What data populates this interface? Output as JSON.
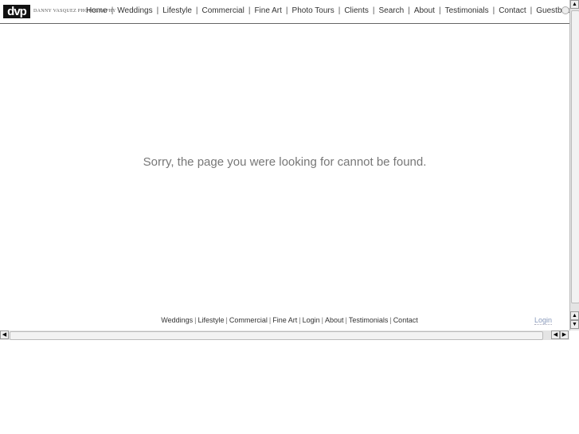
{
  "header": {
    "logo": "dvp",
    "brand": "DANNY VASQUEZ PHOTOGRAPHY",
    "nav": [
      "Home",
      "Weddings",
      "Lifestyle",
      "Commercial",
      "Fine Art",
      "Photo Tours",
      "Clients",
      "Search",
      "About",
      "Testimonials",
      "Contact",
      "Guestbook"
    ],
    "separator": "|"
  },
  "main": {
    "message": "Sorry, the page you were looking for cannot be found."
  },
  "footer": {
    "links": [
      "Weddings",
      "Lifestyle",
      "Commercial",
      "Fine Art",
      "Login",
      "About",
      "Testimonials",
      "Contact"
    ],
    "separator": "|",
    "login": "Login"
  },
  "scrollbars": {
    "up": "▲",
    "down": "▼",
    "left": "◀",
    "right": "▶"
  }
}
